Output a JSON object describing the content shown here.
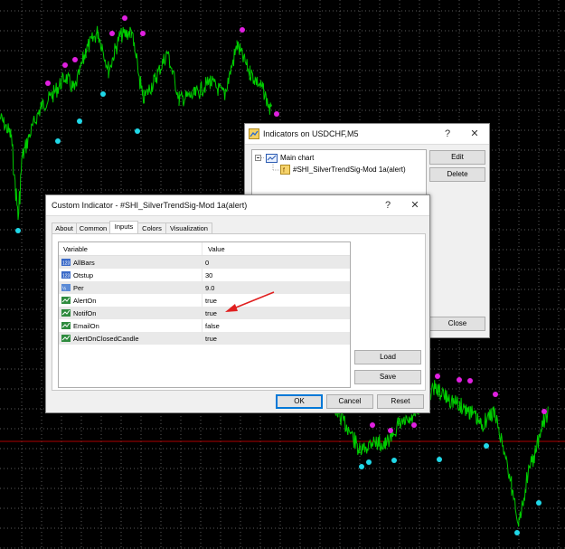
{
  "chart": {
    "colors": {
      "background": "#000000",
      "grid": "#5a5a5a",
      "line": "#00cc00",
      "upper_dot": "#e020e0",
      "lower_dot": "#20d8e8",
      "hline": "#c00000"
    }
  },
  "indicators_window": {
    "title": "Indicators on USDCHF,M5",
    "help_label": "?",
    "close_label": "✕",
    "tree": {
      "root_label": "Main chart",
      "child_label": "#SHI_SilverTrendSig-Mod 1a(alert)"
    },
    "buttons": {
      "edit": "Edit",
      "delete": "Delete",
      "close": "Close"
    }
  },
  "custom_indicator_window": {
    "title": "Custom Indicator - #SHI_SilverTrendSig-Mod 1a(alert)",
    "help_label": "?",
    "close_label": "✕",
    "tabs": [
      "About",
      "Common",
      "Inputs",
      "Colors",
      "Visualization"
    ],
    "active_tab": "Inputs",
    "columns": {
      "variable": "Variable",
      "value": "Value"
    },
    "params": [
      {
        "icon": "int-icon",
        "name": "AllBars",
        "value": "0"
      },
      {
        "icon": "int-icon",
        "name": "Otstup",
        "value": "30"
      },
      {
        "icon": "double-icon",
        "name": "Per",
        "value": "9.0"
      },
      {
        "icon": "bool-icon",
        "name": "AlertOn",
        "value": "true"
      },
      {
        "icon": "bool-icon",
        "name": "NotifOn",
        "value": "true"
      },
      {
        "icon": "bool-icon",
        "name": "EmailOn",
        "value": "false"
      },
      {
        "icon": "bool-icon",
        "name": "AlertOnClosedCandle",
        "value": "true"
      }
    ],
    "buttons": {
      "load": "Load",
      "save": "Save",
      "ok": "OK",
      "cancel": "Cancel",
      "reset": "Reset"
    },
    "annotation_color": "#e02020"
  }
}
